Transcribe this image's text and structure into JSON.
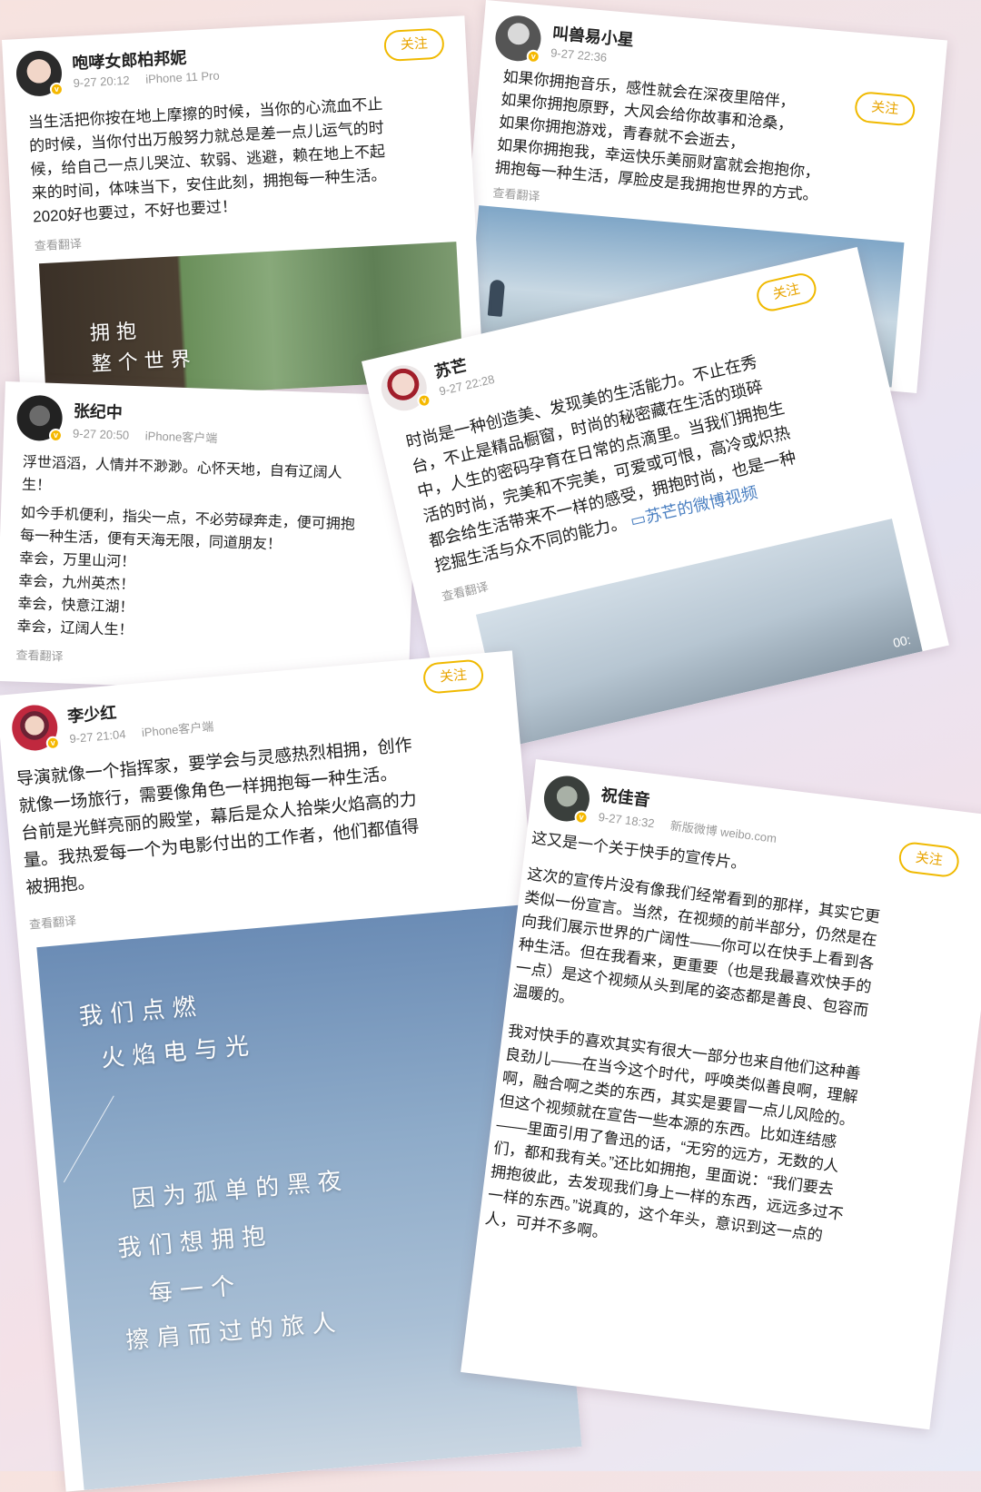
{
  "follow_label": "关注",
  "translate_label": "查看翻译",
  "posts": {
    "p1": {
      "name": "咆哮女郎柏邦妮",
      "time": "9-27 20:12",
      "device": "iPhone 11 Pro",
      "lines": [
        "当生活把你按在地上摩擦的时候，当你的心流血不止",
        "的时候，当你付出万般努力就总是差一点儿运气的时",
        "候，给自己一点儿哭泣、软弱、逃避，赖在地上不起",
        "来的时间，体味当下，安住此刻，拥抱每一种生活。",
        "2020好也要过，不好也要过！"
      ],
      "image_text": [
        "拥 抱",
        "整 个 世 界"
      ]
    },
    "p2": {
      "name": "叫兽易小星",
      "time": "9-27 22:36",
      "lines": [
        "如果你拥抱音乐，感性就会在深夜里陪伴，",
        "如果你拥抱原野，大风会给你故事和沧桑，",
        "如果你拥抱游戏，青春就不会逝去，",
        "如果你拥抱我，幸运快乐美丽财富就会抱抱你，",
        "拥抱每一种生活，厚脸皮是我拥抱世界的方式。"
      ]
    },
    "p3": {
      "name": "张纪中",
      "time": "9-27 20:50",
      "device": "iPhone客户端",
      "lines": [
        "浮世滔滔，人情并不渺渺。心怀天地，自有辽阔人",
        "生！",
        "如今手机便利，指尖一点，不必劳碌奔走，便可拥抱",
        "每一种生活，便有天海无限，同道朋友！",
        "幸会，万里山河！",
        "幸会，九州英杰！",
        "幸会，快意江湖！",
        "幸会，辽阔人生！"
      ]
    },
    "p4": {
      "name": "苏芒",
      "time": "9-27 22:28",
      "lines": [
        "时尚是一种创造美、发现美的生活能力。不止在秀",
        "台，不止是精品橱窗，时尚的秘密藏在生活的琐碎",
        "中，人生的密码孕育在日常的点滴里。当我们拥抱生",
        "活的时尚，完美和不完美，可爱或可恨，高冷或炽热",
        "都会给生活带来不一样的感受，拥抱时尚，也是一种",
        "挖掘生活与众不同的能力。"
      ],
      "video_link": "苏芒的微博视频",
      "video_time": "00:"
    },
    "p5": {
      "name": "李少红",
      "time": "9-27 21:04",
      "device": "iPhone客户端",
      "lines": [
        "导演就像一个指挥家，要学会与灵感热烈相拥，创作",
        "就像一场旅行，需要像角色一样拥抱每一种生活。",
        "台前是光鲜亮丽的殿堂，幕后是众人拾柴火焰高的力",
        "量。我热爱每一个为电影付出的工作者，他们都值得",
        "被拥抱。"
      ],
      "poem": [
        "我 们 点 燃",
        "火 焰   电   与 光",
        "因 为 孤 单 的 黑 夜",
        "我 们 想    拥 抱",
        "每 一 个",
        "擦 肩 而 过 的      旅 人"
      ]
    },
    "p6": {
      "name": "祝佳音",
      "time": "9-27 18:32",
      "device": "新版微博 weibo.com",
      "intro": "这又是一个关于快手的宣传片。",
      "para1": [
        "这次的宣传片没有像我们经常看到的那样，其实它更",
        "类似一份宣言。当然，在视频的前半部分，仍然是在",
        "向我们展示世界的广阔性——你可以在快手上看到各",
        "种生活。但在我看来，更重要（也是我最喜欢快手的",
        "一点）是这个视频从头到尾的姿态都是善良、包容而",
        "温暖的。"
      ],
      "para2": [
        "我对快手的喜欢其实有很大一部分也来自他们这种善",
        "良劲儿——在当今这个时代，呼唤类似善良啊，理解",
        "啊，融合啊之类的东西，其实是要冒一点儿风险的。",
        "但这个视频就在宣告一些本源的东西。比如连结感",
        "——里面引用了鲁迅的话，“无穷的远方，无数的人",
        "们，都和我有关。”还比如拥抱，里面说：“我们要去",
        "拥抱彼此，去发现我们身上一样的东西，远远多过不",
        "一样的东西。”说真的，这个年头，意识到这一点的",
        "人，可并不多啊。"
      ]
    }
  }
}
